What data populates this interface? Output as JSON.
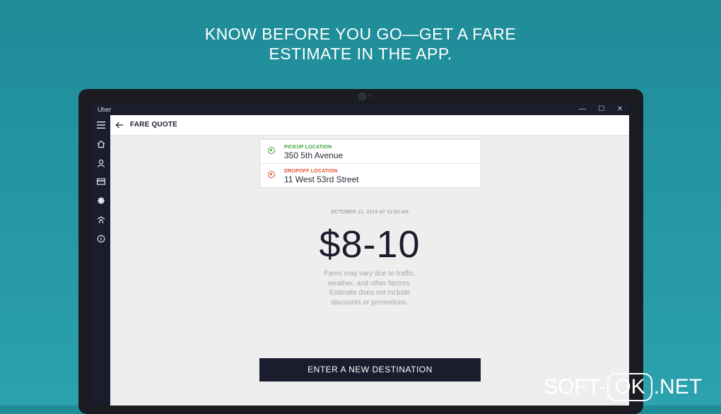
{
  "headline": {
    "line1": "KNOW BEFORE YOU GO—GET A FARE",
    "line2": "ESTIMATE IN THE APP."
  },
  "window": {
    "title": "Uber",
    "controls": {
      "minimize": "—",
      "maximize": "☐",
      "close": "✕"
    }
  },
  "sidebar": {
    "items": [
      {
        "icon": "hamburger-menu-icon"
      },
      {
        "icon": "home-icon"
      },
      {
        "icon": "person-icon"
      },
      {
        "icon": "payment-card-icon"
      },
      {
        "icon": "promotions-icon"
      },
      {
        "icon": "drive-icon"
      },
      {
        "icon": "info-icon"
      }
    ]
  },
  "header": {
    "title": "FARE QUOTE"
  },
  "locations": {
    "pickup": {
      "label": "PICKUP LOCATION",
      "value": "350 5th Avenue",
      "color": "#3aa43a"
    },
    "dropoff": {
      "label": "DROPOFF LOCATION",
      "value": "11 West 53rd Street",
      "color": "#e2502b"
    }
  },
  "quote": {
    "timestamp": "OCTOBER 21, 2015 AT 11:53 AM",
    "fare": "$8-10",
    "disclaimer": [
      "Fares may vary due to traffic,",
      "weather, and other factors.",
      "Estimate does not include",
      "discounts or promotions."
    ]
  },
  "cta": {
    "label": "ENTER A NEW DESTINATION"
  },
  "watermark": {
    "part1": "SOFT-",
    "part2": "OK",
    "part3": ".NET"
  },
  "colors": {
    "background": "#2497a3",
    "dark_navy": "#1b1d2e",
    "screen_bg": "#eeeeef"
  }
}
